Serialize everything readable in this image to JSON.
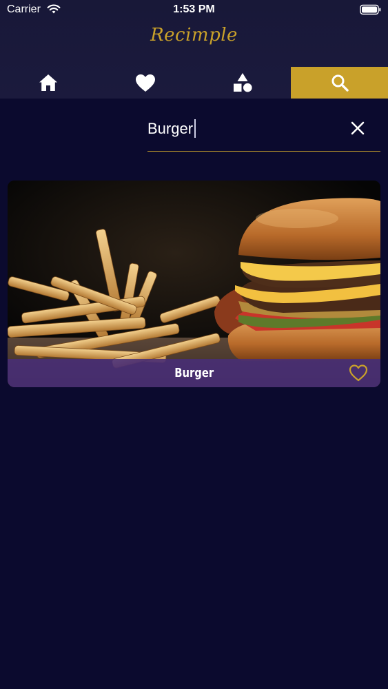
{
  "status_bar": {
    "carrier": "Carrier",
    "time": "1:53 PM"
  },
  "app": {
    "title": "Recimple",
    "accent_color": "#c9a12a",
    "background_color": "#0b0a2e"
  },
  "tabs": [
    {
      "icon": "home-icon",
      "active": false
    },
    {
      "icon": "heart-icon",
      "active": false
    },
    {
      "icon": "shapes-icon",
      "active": false
    },
    {
      "icon": "search-icon",
      "active": true
    }
  ],
  "search": {
    "value": "Burger",
    "clear_icon": "close-icon"
  },
  "results": [
    {
      "title": "Burger",
      "image": "burger-and-fries-photo",
      "favorite_icon": "heart-outline-icon",
      "favorited": false
    }
  ]
}
